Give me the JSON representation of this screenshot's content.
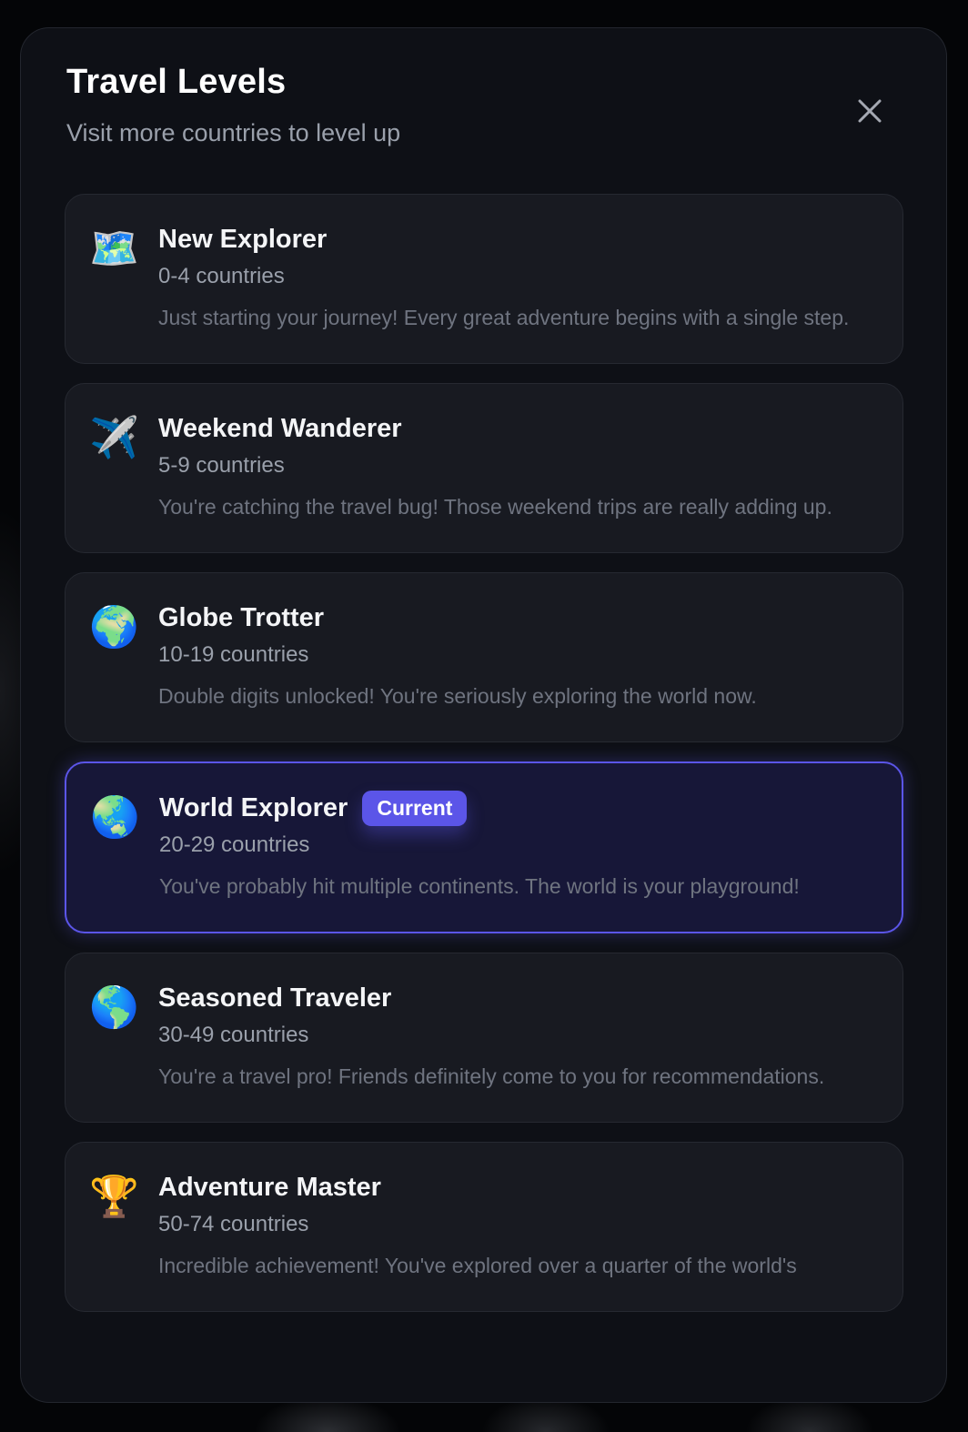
{
  "modal": {
    "title": "Travel Levels",
    "subtitle": "Visit more countries to level up",
    "close_icon": "close-icon"
  },
  "levels": [
    {
      "icon": "map-icon",
      "emoji": "🗺️",
      "name": "New Explorer",
      "range": "0-4 countries",
      "description": "Just starting your journey! Every great adventure begins with a single step.",
      "current": false
    },
    {
      "icon": "airplane-icon",
      "emoji": "✈️",
      "name": "Weekend Wanderer",
      "range": "5-9 countries",
      "description": "You're catching the travel bug! Those weekend trips are really adding up.",
      "current": false
    },
    {
      "icon": "globe-europe-africa-icon",
      "emoji": "🌍",
      "name": "Globe Trotter",
      "range": "10-19 countries",
      "description": "Double digits unlocked! You're seriously exploring the world now.",
      "current": false
    },
    {
      "icon": "globe-asia-australia-icon",
      "emoji": "🌏",
      "name": "World Explorer",
      "range": "20-29 countries",
      "description": "You've probably hit multiple continents. The world is your playground!",
      "current": true,
      "badge": "Current"
    },
    {
      "icon": "globe-americas-icon",
      "emoji": "🌎",
      "name": "Seasoned Traveler",
      "range": "30-49 countries",
      "description": "You're a travel pro! Friends definitely come to you for recommendations.",
      "current": false
    },
    {
      "icon": "trophy-icon",
      "emoji": "🏆",
      "name": "Adventure Master",
      "range": "50-74 countries",
      "description": "Incredible achievement! You've explored over a quarter of the world's",
      "current": false
    }
  ],
  "colors": {
    "accent": "#5b55e8",
    "card_bg": "#181a21",
    "current_bg": "#171738",
    "modal_bg": "#0e1016"
  }
}
